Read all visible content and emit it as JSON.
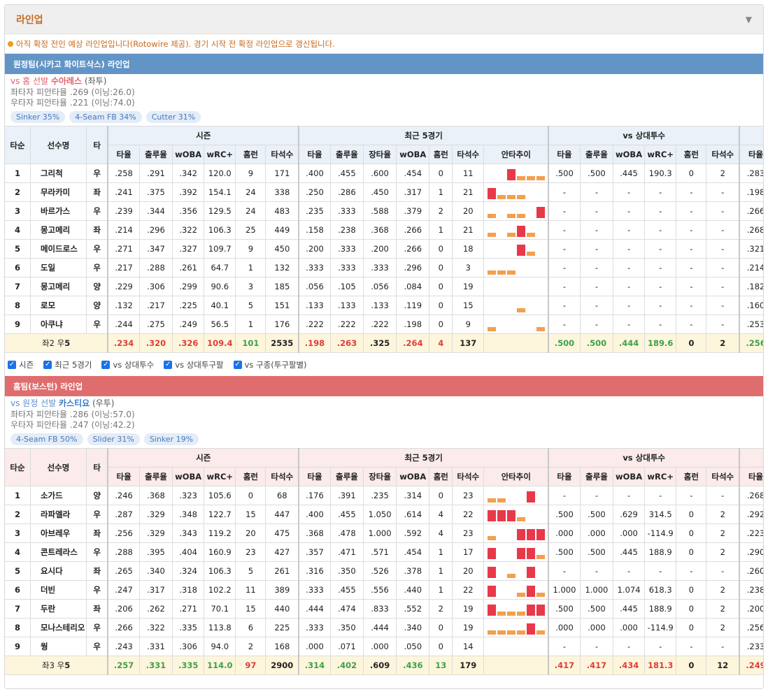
{
  "title": "라인업",
  "notice": "아직 확정 전인 예상 라인업입니다(Rotowire 제공). 경기 시작 전 확정 라인업으로 갱신됩니다.",
  "columns": {
    "order": "타순",
    "name": "선수명",
    "hand": "타",
    "groups": [
      "시즌",
      "최근 5경기",
      "vs 상대투수"
    ],
    "season": [
      "타율",
      "출루율",
      "wOBA",
      "wRC+",
      "홈런",
      "타석수"
    ],
    "recent": [
      "타율",
      "출루율",
      "장타율",
      "wOBA",
      "홈런",
      "타석수",
      "안타추이"
    ],
    "vs": [
      "타율",
      "출루율",
      "wOBA",
      "wRC+",
      "홈런",
      "타석수"
    ],
    "extra": "타율"
  },
  "checks": [
    "시즌",
    "최근 5경기",
    "vs 상대투수",
    "vs 상대투구팔",
    "vs 구종(투구팔별)"
  ],
  "away": {
    "team_title": "원정팀(시카고 화이트삭스) 라인업",
    "pitcher_prefix": "vs 홈 선발",
    "pitcher_name": "수아레스",
    "pitcher_hand": "(좌투)",
    "split_l": "좌타자 피안타율 .269 (이닝:26.0)",
    "split_r": "우타자 피안타율 .221 (이닝:74.0)",
    "pitches": [
      "Sinker 35%",
      "4-Seam FB 34%",
      "Cutter 31%"
    ],
    "players": [
      {
        "o": "1",
        "n": "그리척",
        "h": "우",
        "s": [
          ".258",
          ".291",
          ".342",
          "120.0",
          "9",
          "171"
        ],
        "r": [
          ".400",
          ".455",
          ".600",
          ".454",
          "0",
          "11"
        ],
        "t": [
          0,
          0,
          1,
          0.5,
          0.5,
          0.5
        ],
        "tc": [
          "o",
          "o",
          "r",
          "o",
          "o",
          "o"
        ],
        "v": [
          ".500",
          ".500",
          ".445",
          "190.3",
          "0",
          "2"
        ],
        "x": ".283"
      },
      {
        "o": "2",
        "n": "무라카미",
        "h": "좌",
        "s": [
          ".241",
          ".375",
          ".392",
          "154.1",
          "24",
          "338"
        ],
        "r": [
          ".250",
          ".286",
          ".450",
          ".317",
          "1",
          "21"
        ],
        "t": [
          1,
          0.5,
          0.5,
          0.5,
          0,
          0
        ],
        "tc": [
          "r",
          "o",
          "o",
          "o",
          "o",
          "o"
        ],
        "v": [
          "-",
          "-",
          "-",
          "-",
          "-",
          "-"
        ],
        "x": ".198"
      },
      {
        "o": "3",
        "n": "바르가스",
        "h": "우",
        "s": [
          ".239",
          ".344",
          ".356",
          "129.5",
          "24",
          "483"
        ],
        "r": [
          ".235",
          ".333",
          ".588",
          ".379",
          "2",
          "20"
        ],
        "t": [
          0.5,
          0,
          0.5,
          0.5,
          0,
          1
        ],
        "tc": [
          "o",
          "o",
          "o",
          "o",
          "o",
          "r"
        ],
        "v": [
          "-",
          "-",
          "-",
          "-",
          "-",
          "-"
        ],
        "x": ".266"
      },
      {
        "o": "4",
        "n": "몽고메리",
        "h": "좌",
        "s": [
          ".214",
          ".296",
          ".322",
          "106.3",
          "25",
          "449"
        ],
        "r": [
          ".158",
          ".238",
          ".368",
          ".266",
          "1",
          "21"
        ],
        "t": [
          0.5,
          0,
          0.5,
          1,
          0.5,
          0
        ],
        "tc": [
          "o",
          "o",
          "o",
          "r",
          "o",
          "o"
        ],
        "v": [
          "-",
          "-",
          "-",
          "-",
          "-",
          "-"
        ],
        "x": ".268"
      },
      {
        "o": "5",
        "n": "메이드로스",
        "h": "우",
        "s": [
          ".271",
          ".347",
          ".327",
          "109.7",
          "9",
          "450"
        ],
        "r": [
          ".200",
          ".333",
          ".200",
          ".266",
          "0",
          "18"
        ],
        "t": [
          0,
          0,
          0,
          1,
          0.5,
          0
        ],
        "tc": [
          "o",
          "o",
          "o",
          "r",
          "o",
          "o"
        ],
        "v": [
          "-",
          "-",
          "-",
          "-",
          "-",
          "-"
        ],
        "x": ".321"
      },
      {
        "o": "6",
        "n": "도일",
        "h": "우",
        "s": [
          ".217",
          ".288",
          ".261",
          "64.7",
          "1",
          "132"
        ],
        "r": [
          ".333",
          ".333",
          ".333",
          ".296",
          "0",
          "3"
        ],
        "t": [
          0.5,
          0.5,
          0.5,
          0,
          0,
          0
        ],
        "tc": [
          "o",
          "o",
          "o",
          "o",
          "o",
          "o"
        ],
        "v": [
          "-",
          "-",
          "-",
          "-",
          "-",
          "-"
        ],
        "x": ".214"
      },
      {
        "o": "7",
        "n": "몽고메리",
        "h": "양",
        "s": [
          ".229",
          ".306",
          ".299",
          "90.6",
          "3",
          "185"
        ],
        "r": [
          ".056",
          ".105",
          ".056",
          ".084",
          "0",
          "19"
        ],
        "t": [
          0,
          0,
          0,
          0,
          0,
          0
        ],
        "tc": [
          "o",
          "o",
          "o",
          "o",
          "o",
          "o"
        ],
        "v": [
          "-",
          "-",
          "-",
          "-",
          "-",
          "-"
        ],
        "x": ".182"
      },
      {
        "o": "8",
        "n": "로모",
        "h": "양",
        "s": [
          ".132",
          ".217",
          ".225",
          "40.1",
          "5",
          "151"
        ],
        "r": [
          ".133",
          ".133",
          ".133",
          ".119",
          "0",
          "15"
        ],
        "t": [
          0,
          0,
          0,
          0.5,
          0,
          0
        ],
        "tc": [
          "o",
          "o",
          "o",
          "o",
          "o",
          "o"
        ],
        "v": [
          "-",
          "-",
          "-",
          "-",
          "-",
          "-"
        ],
        "x": ".160"
      },
      {
        "o": "9",
        "n": "아쿠냐",
        "h": "우",
        "s": [
          ".244",
          ".275",
          ".249",
          "56.5",
          "1",
          "176"
        ],
        "r": [
          ".222",
          ".222",
          ".222",
          ".198",
          "0",
          "9"
        ],
        "t": [
          0.5,
          0,
          0,
          0,
          0,
          0.5
        ],
        "tc": [
          "o",
          "o",
          "o",
          "o",
          "o",
          "o"
        ],
        "v": [
          "-",
          "-",
          "-",
          "-",
          "-",
          "-"
        ],
        "x": ".253"
      }
    ],
    "total": {
      "label_pre": "좌2 우",
      "label_num": "5",
      "s": [
        ".234",
        ".320",
        ".326",
        "109.4",
        "101",
        "2535"
      ],
      "r": [
        ".198",
        ".263",
        ".325",
        ".264",
        "4",
        "137"
      ],
      "v": [
        ".500",
        ".500",
        ".444",
        "189.6",
        "0",
        "2"
      ],
      "x": ".256"
    }
  },
  "home": {
    "team_title": "홈팀(보스턴) 라인업",
    "pitcher_prefix": "vs 원정 선발",
    "pitcher_name": "카스티요",
    "pitcher_hand": "(우투)",
    "split_l": "좌타자 피안타율 .286 (이닝:57.0)",
    "split_r": "우타자 피안타율 .247 (이닝:42.2)",
    "pitches": [
      "4-Seam FB 50%",
      "Slider 31%",
      "Sinker 19%"
    ],
    "players": [
      {
        "o": "1",
        "n": "소가드",
        "h": "양",
        "s": [
          ".246",
          ".368",
          ".323",
          "105.6",
          "0",
          "68"
        ],
        "r": [
          ".176",
          ".391",
          ".235",
          ".314",
          "0",
          "23"
        ],
        "t": [
          0.5,
          0.5,
          0,
          0,
          1,
          0
        ],
        "tc": [
          "o",
          "o",
          "o",
          "o",
          "r",
          "o"
        ],
        "v": [
          "-",
          "-",
          "-",
          "-",
          "-",
          "-"
        ],
        "x": ".268"
      },
      {
        "o": "2",
        "n": "라파엘라",
        "h": "우",
        "s": [
          ".287",
          ".329",
          ".348",
          "122.7",
          "15",
          "447"
        ],
        "r": [
          ".400",
          ".455",
          "1.050",
          ".614",
          "4",
          "22"
        ],
        "t": [
          1,
          1,
          1,
          0.5,
          0,
          0
        ],
        "tc": [
          "r",
          "r",
          "r",
          "o",
          "o",
          "o"
        ],
        "v": [
          ".500",
          ".500",
          ".629",
          "314.5",
          "0",
          "2"
        ],
        "x": ".292"
      },
      {
        "o": "3",
        "n": "아브레우",
        "h": "좌",
        "s": [
          ".256",
          ".329",
          ".343",
          "119.2",
          "20",
          "475"
        ],
        "r": [
          ".368",
          ".478",
          "1.000",
          ".592",
          "4",
          "23"
        ],
        "t": [
          0.5,
          0,
          0,
          1,
          1,
          1
        ],
        "tc": [
          "o",
          "o",
          "o",
          "r",
          "r",
          "r"
        ],
        "v": [
          ".000",
          ".000",
          ".000",
          "-114.9",
          "0",
          "2"
        ],
        "x": ".223"
      },
      {
        "o": "4",
        "n": "콘트레라스",
        "h": "우",
        "s": [
          ".288",
          ".395",
          ".404",
          "160.9",
          "23",
          "427"
        ],
        "r": [
          ".357",
          ".471",
          ".571",
          ".454",
          "1",
          "17"
        ],
        "t": [
          1,
          0,
          0,
          1,
          1,
          0.5
        ],
        "tc": [
          "r",
          "o",
          "o",
          "r",
          "r",
          "o"
        ],
        "v": [
          ".500",
          ".500",
          ".445",
          "188.9",
          "0",
          "2"
        ],
        "x": ".290"
      },
      {
        "o": "5",
        "n": "요시다",
        "h": "좌",
        "s": [
          ".265",
          ".340",
          ".324",
          "106.3",
          "5",
          "261"
        ],
        "r": [
          ".316",
          ".350",
          ".526",
          ".378",
          "1",
          "20"
        ],
        "t": [
          1,
          0,
          0.5,
          0,
          1,
          0
        ],
        "tc": [
          "r",
          "o",
          "o",
          "o",
          "r",
          "o"
        ],
        "v": [
          "-",
          "-",
          "-",
          "-",
          "-",
          "-"
        ],
        "x": ".260"
      },
      {
        "o": "6",
        "n": "더빈",
        "h": "우",
        "s": [
          ".247",
          ".317",
          ".318",
          "102.2",
          "11",
          "389"
        ],
        "r": [
          ".333",
          ".455",
          ".556",
          ".440",
          "1",
          "22"
        ],
        "t": [
          1,
          0,
          0,
          0.5,
          1,
          0.5
        ],
        "tc": [
          "r",
          "o",
          "o",
          "o",
          "r",
          "o"
        ],
        "v": [
          "1.000",
          "1.000",
          "1.074",
          "618.3",
          "0",
          "2"
        ],
        "x": ".238"
      },
      {
        "o": "7",
        "n": "두란",
        "h": "좌",
        "s": [
          ".206",
          ".262",
          ".271",
          "70.1",
          "15",
          "440"
        ],
        "r": [
          ".444",
          ".474",
          ".833",
          ".552",
          "2",
          "19"
        ],
        "t": [
          1,
          0.5,
          0.5,
          0.5,
          1,
          1
        ],
        "tc": [
          "r",
          "o",
          "o",
          "o",
          "r",
          "r"
        ],
        "v": [
          ".500",
          ".500",
          ".445",
          "188.9",
          "0",
          "2"
        ],
        "x": ".200"
      },
      {
        "o": "8",
        "n": "모나스테리오",
        "h": "우",
        "s": [
          ".266",
          ".322",
          ".335",
          "113.8",
          "6",
          "225"
        ],
        "r": [
          ".333",
          ".350",
          ".444",
          ".340",
          "0",
          "19"
        ],
        "t": [
          0.5,
          0.5,
          0.5,
          0.5,
          1,
          0.5
        ],
        "tc": [
          "o",
          "o",
          "o",
          "o",
          "r",
          "o"
        ],
        "v": [
          ".000",
          ".000",
          ".000",
          "-114.9",
          "0",
          "2"
        ],
        "x": ".256"
      },
      {
        "o": "9",
        "n": "웡",
        "h": "우",
        "s": [
          ".243",
          ".331",
          ".306",
          "94.0",
          "2",
          "168"
        ],
        "r": [
          ".000",
          ".071",
          ".000",
          ".050",
          "0",
          "14"
        ],
        "t": [
          0,
          0,
          0,
          0,
          0,
          0
        ],
        "tc": [
          "o",
          "o",
          "o",
          "o",
          "o",
          "o"
        ],
        "v": [
          "-",
          "-",
          "-",
          "-",
          "-",
          "-"
        ],
        "x": ".233"
      }
    ],
    "total": {
      "label_pre": "좌3 우",
      "label_num": "5",
      "s": [
        ".257",
        ".331",
        ".335",
        "114.0",
        "97",
        "2900"
      ],
      "r": [
        ".314",
        ".402",
        ".609",
        ".436",
        "13",
        "179"
      ],
      "v": [
        ".417",
        ".417",
        ".434",
        "181.3",
        "0",
        "12"
      ],
      "x": ".249"
    }
  },
  "colors": {
    "red": "#e8394a",
    "orange": "#f2a050"
  }
}
